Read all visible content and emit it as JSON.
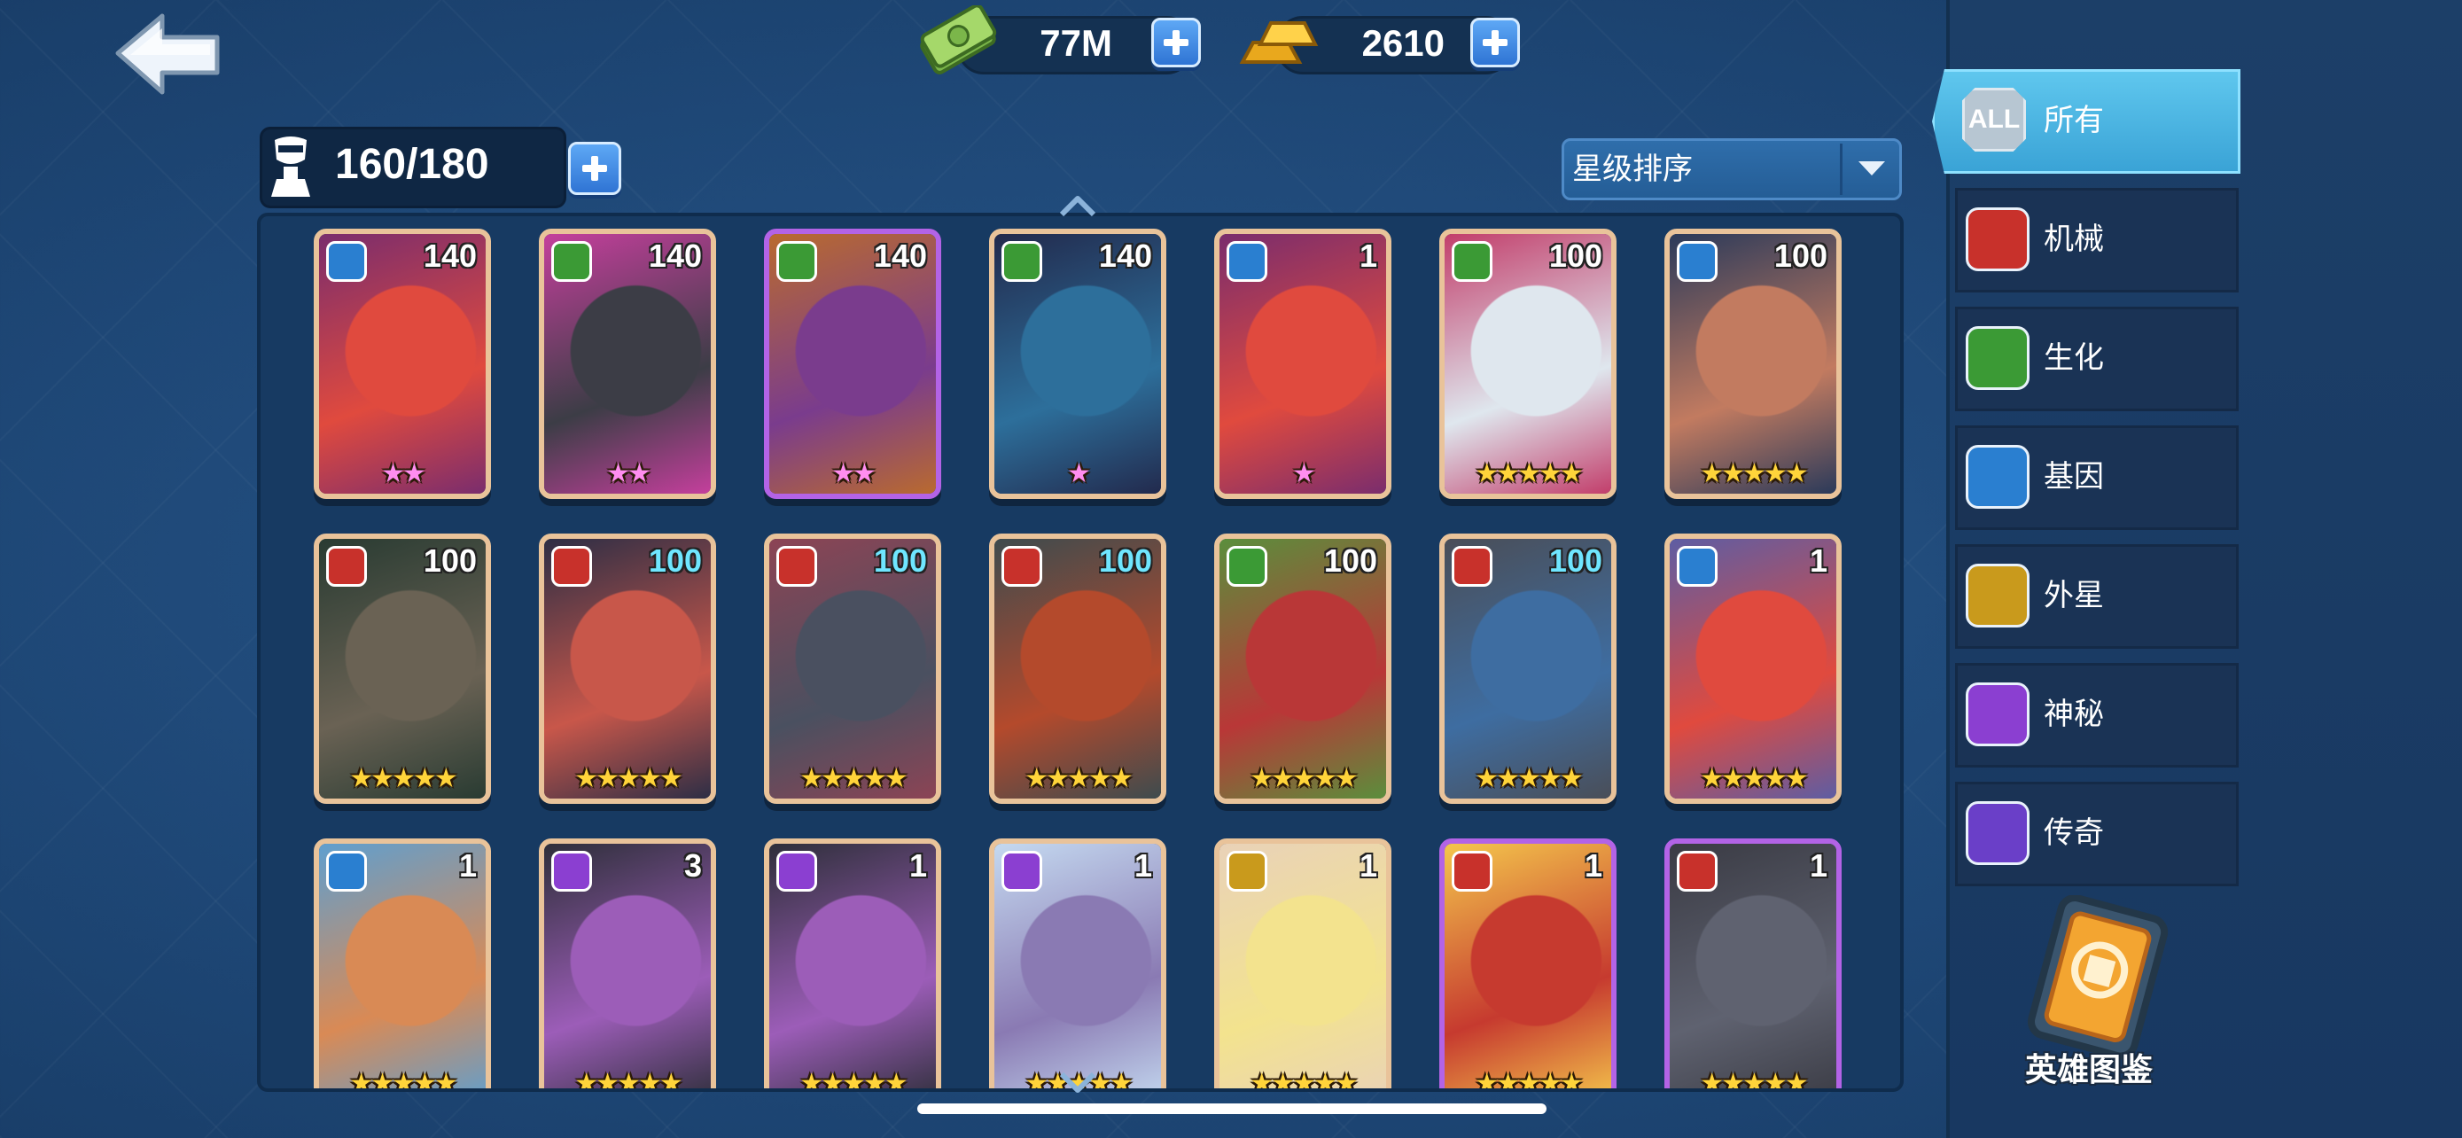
{
  "header": {
    "cash_value": "77M",
    "gold_value": "2610"
  },
  "capacity": {
    "value": "160/180"
  },
  "sort": {
    "label": "星级排序"
  },
  "categories": [
    {
      "key": "all",
      "icon_text": "ALL",
      "label": "所有",
      "active": true
    },
    {
      "key": "mech",
      "label": "机械",
      "icon": "wrench-gear-icon"
    },
    {
      "key": "bio",
      "label": "生化",
      "icon": "flask-icon"
    },
    {
      "key": "gene",
      "label": "基因",
      "icon": "dna-icon"
    },
    {
      "key": "alien",
      "label": "外星",
      "icon": "alien-icon"
    },
    {
      "key": "mystic",
      "label": "神秘",
      "icon": "question-icon"
    },
    {
      "key": "legend",
      "label": "传奇",
      "icon": "legend-emblem-icon"
    }
  ],
  "codex": {
    "label": "英雄图鉴"
  },
  "heroes": [
    {
      "type": "gene",
      "level": "140",
      "stars": "★★",
      "star_color": "pink"
    },
    {
      "type": "bio",
      "level": "140",
      "stars": "★★",
      "star_color": "pink"
    },
    {
      "type": "bio",
      "level": "140",
      "stars": "★★",
      "star_color": "pink",
      "frame": "purple"
    },
    {
      "type": "bio",
      "level": "140",
      "stars": "★",
      "star_color": "pink"
    },
    {
      "type": "gene",
      "level": "1",
      "stars": "★",
      "star_color": "pink"
    },
    {
      "type": "bio",
      "level": "100",
      "stars": "★★★★★",
      "star_color": "gold"
    },
    {
      "type": "gene",
      "level": "100",
      "stars": "★★★★★",
      "star_color": "gold"
    },
    {
      "type": "mech",
      "level": "100",
      "stars": "★★★★★",
      "star_color": "gold"
    },
    {
      "type": "mech",
      "level": "100",
      "stars": "★★★★★",
      "star_color": "gold",
      "level_color": "cyan"
    },
    {
      "type": "mech",
      "level": "100",
      "stars": "★★★★★",
      "star_color": "gold",
      "level_color": "cyan"
    },
    {
      "type": "mech",
      "level": "100",
      "stars": "★★★★★",
      "star_color": "gold",
      "level_color": "cyan"
    },
    {
      "type": "bio",
      "level": "100",
      "stars": "★★★★★",
      "star_color": "gold"
    },
    {
      "type": "mech",
      "level": "100",
      "stars": "★★★★★",
      "star_color": "gold",
      "level_color": "cyan"
    },
    {
      "type": "gene",
      "level": "1",
      "stars": "★★★★★",
      "star_color": "gold"
    },
    {
      "type": "gene",
      "level": "1",
      "stars": "★★★★★",
      "star_color": "gold"
    },
    {
      "type": "mystic",
      "level": "3",
      "stars": "★★★★★",
      "star_color": "gold"
    },
    {
      "type": "mystic",
      "level": "1",
      "stars": "★★★★★",
      "star_color": "gold"
    },
    {
      "type": "mystic",
      "level": "1",
      "stars": "★★★★★",
      "star_color": "gold"
    },
    {
      "type": "alien",
      "level": "1",
      "stars": "★★★★★",
      "star_color": "gold"
    },
    {
      "type": "mech",
      "level": "1",
      "stars": "★★★★★",
      "star_color": "gold",
      "frame": "purple"
    },
    {
      "type": "mech",
      "level": "1",
      "stars": "★★★★★",
      "star_color": "gold",
      "frame": "purple"
    }
  ]
}
